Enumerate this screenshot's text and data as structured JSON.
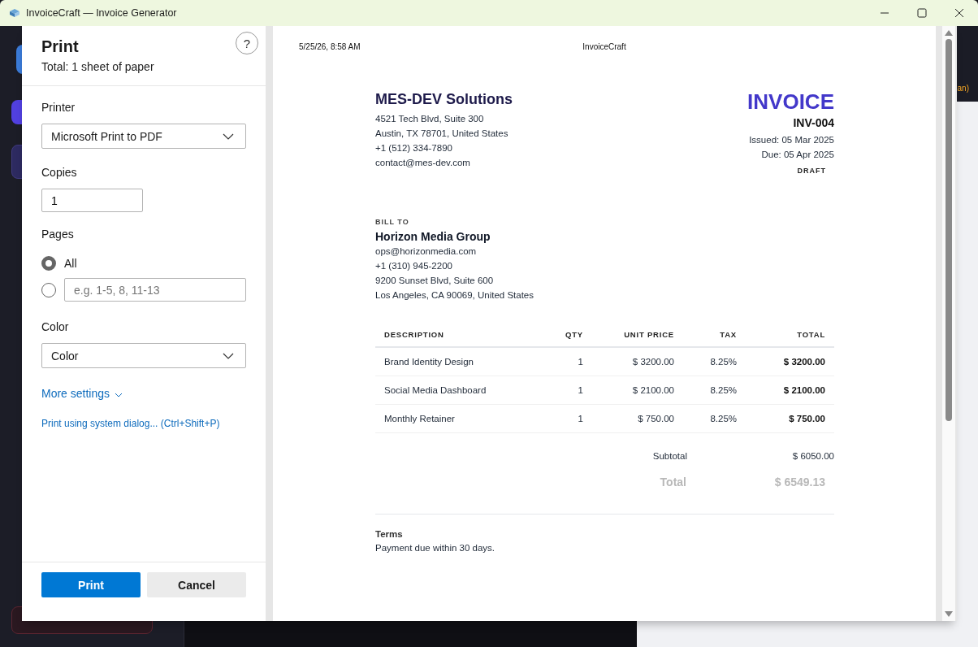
{
  "window": {
    "title": "InvoiceCraft — Invoice Generator"
  },
  "background": {
    "side_note": "an)"
  },
  "print_dialog": {
    "title": "Print",
    "subtitle": "Total: 1 sheet of paper",
    "help": "?",
    "printer": {
      "label": "Printer",
      "value": "Microsoft Print to PDF"
    },
    "copies": {
      "label": "Copies",
      "value": "1"
    },
    "pages": {
      "label": "Pages",
      "options": [
        {
          "kind": "all",
          "label": "All",
          "selected": true
        },
        {
          "kind": "range",
          "placeholder": "e.g. 1-5, 8, 11-13",
          "selected": false
        }
      ]
    },
    "color": {
      "label": "Color",
      "value": "Color"
    },
    "more_settings": "More settings",
    "system_dialog_link": "Print using system dialog... (Ctrl+Shift+P)",
    "buttons": [
      {
        "kind": "primary",
        "label": "Print"
      },
      {
        "kind": "secondary",
        "label": "Cancel"
      }
    ]
  },
  "preview": {
    "header_date": "5/25/26, 8:58 AM",
    "header_title": "InvoiceCraft",
    "company": "MES-DEV Solutions",
    "company_lines": [
      "4521 Tech Blvd, Suite 300",
      "Austin, TX 78701, United States",
      "+1 (512) 334-7890",
      "contact@mes-dev.com"
    ],
    "doc_title": "INVOICE",
    "number": "INV-004",
    "issued": "Issued: 05 Mar 2025",
    "due": "Due: 05 Apr 2025",
    "status": "DRAFT",
    "bill_to_label": "BILL TO",
    "client": "Horizon Media Group",
    "client_lines": [
      "ops@horizonmedia.com",
      "+1 (310) 945-2200",
      "9200 Sunset Blvd, Suite 600",
      "Los Angeles, CA 90069, United States"
    ],
    "columns": [
      "DESCRIPTION",
      "QTY",
      "UNIT PRICE",
      "TAX",
      "TOTAL"
    ],
    "rows": [
      [
        "Brand Identity Design",
        "1",
        "$ 3200.00",
        "8.25%",
        "$ 3200.00"
      ],
      [
        "Social Media Dashboard",
        "1",
        "$ 2100.00",
        "8.25%",
        "$ 2100.00"
      ],
      [
        "Monthly Retainer",
        "1",
        "$ 750.00",
        "8.25%",
        "$ 750.00"
      ]
    ],
    "subtotal_label": "Subtotal",
    "subtotal": "$ 6050.00",
    "total_label": "Total",
    "total": "$ 6549.13",
    "terms_label": "Terms",
    "terms": "Payment due within 30 days."
  }
}
